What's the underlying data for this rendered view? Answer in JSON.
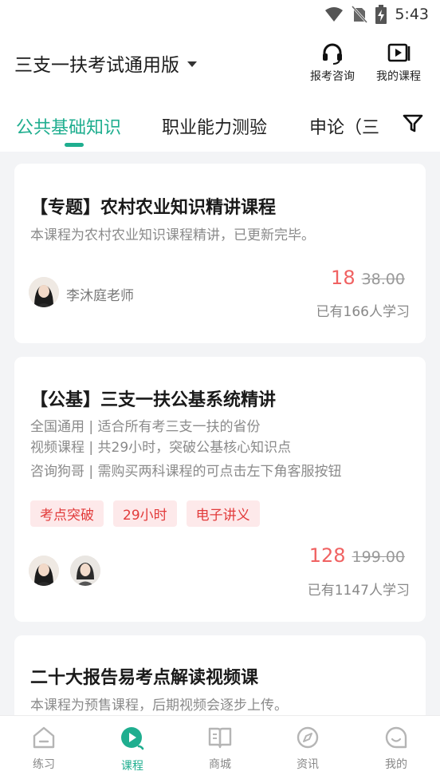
{
  "status_bar": {
    "time": "5:43",
    "icons": [
      "wifi-icon",
      "no-sim-icon",
      "battery-charging-icon"
    ]
  },
  "header": {
    "exam_title": "三支一扶考试通用版",
    "consult_label": "报考咨询",
    "my_courses_label": "我的课程"
  },
  "tabs": [
    {
      "label": "公共基础知识",
      "active": true
    },
    {
      "label": "职业能力测验",
      "active": false
    },
    {
      "label": "申论（三",
      "active": false
    }
  ],
  "courses": [
    {
      "title": "【专题】农村农业知识精讲课程",
      "desc": [
        "本课程为农村农业知识课程精讲，已更新完毕。"
      ],
      "teacher": "李沐庭老师",
      "price": "18",
      "original_price": "38.00",
      "learners": "已有166人学习"
    },
    {
      "title": "【公基】三支一扶公基系统精讲",
      "desc": [
        "全国通用 | 适合所有考三支一扶的省份",
        "视频课程 | 共29小时，突破公基核心知识点",
        "咨询狗哥 | 需购买两科课程的可点击左下角客服按钮"
      ],
      "tags": [
        "考点突破",
        "29小时",
        "电子讲义"
      ],
      "price": "128",
      "original_price": "199.00",
      "learners": "已有1147人学习"
    },
    {
      "title": "二十大报告易考点解读视频课",
      "desc": [
        "本课程为预售课程，后期视频会逐步上传。"
      ]
    }
  ],
  "bottom_nav": [
    {
      "label": "练习",
      "icon": "practice-icon",
      "active": false
    },
    {
      "label": "课程",
      "icon": "play-course-icon",
      "active": true
    },
    {
      "label": "商城",
      "icon": "book-store-icon",
      "active": false
    },
    {
      "label": "资讯",
      "icon": "compass-icon",
      "active": false
    },
    {
      "label": "我的",
      "icon": "profile-icon",
      "active": false
    }
  ],
  "colors": {
    "accent": "#1fae8f",
    "price": "#f06262",
    "tag_bg": "#fde9ea",
    "tag_text": "#e23b3b"
  }
}
